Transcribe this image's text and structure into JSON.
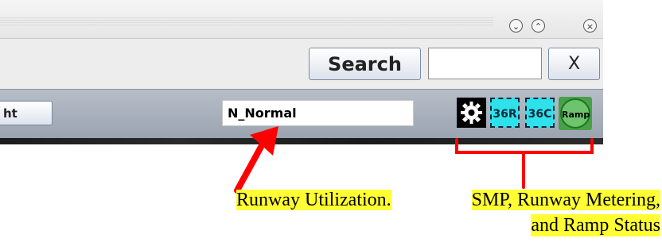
{
  "window": {
    "buttons": [
      {
        "name": "minimize",
        "symbol": "⌄"
      },
      {
        "name": "maximize",
        "symbol": "⌃"
      },
      {
        "name": "close",
        "symbol": "×"
      }
    ]
  },
  "search": {
    "button_label": "Search",
    "input_value": "",
    "clear_label": "X"
  },
  "toolbar": {
    "night_button_label": "ht",
    "runway_utilization_value": "N_Normal",
    "indicators": {
      "smp": {
        "icon": "gear-icon",
        "color": "#000000"
      },
      "runway_36r": {
        "label": "36R",
        "color": "#2fe1ea"
      },
      "runway_36c": {
        "label": "36C",
        "color": "#2fe1ea"
      },
      "ramp": {
        "label": "Ramp",
        "color": "#6ec36e"
      }
    }
  },
  "annotations": {
    "runway_caption": "Runway Utilization.",
    "status_caption_line1": "SMP, Runway Metering,",
    "status_caption_line2": "and Ramp Status",
    "highlight_color": "#ffff33",
    "arrow_color": "#ff0000"
  }
}
